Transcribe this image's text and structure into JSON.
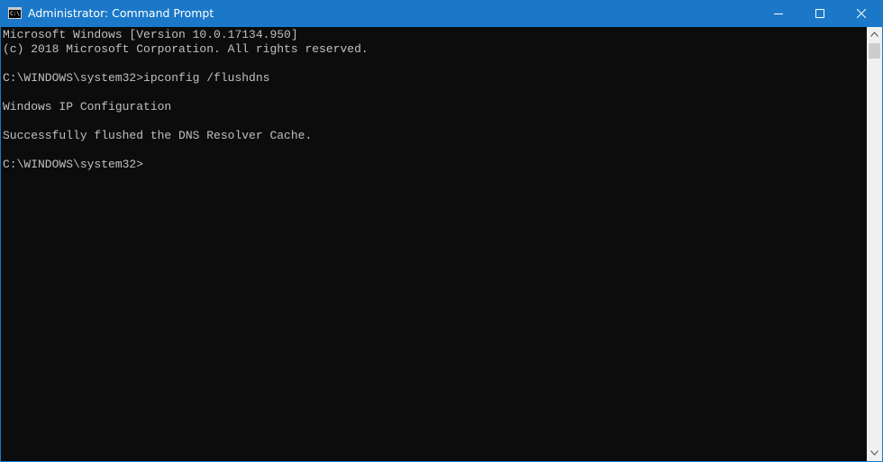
{
  "window": {
    "title": "Administrator: Command Prompt",
    "app_icon_glyph": "C:\\"
  },
  "titlebar": {
    "controls": [
      "minimize-icon",
      "maximize-icon",
      "close-icon"
    ]
  },
  "console": {
    "lines": [
      "Microsoft Windows [Version 10.0.17134.950]",
      "(c) 2018 Microsoft Corporation. All rights reserved.",
      "",
      "C:\\WINDOWS\\system32>ipconfig /flushdns",
      "",
      "Windows IP Configuration",
      "",
      "Successfully flushed the DNS Resolver Cache.",
      "",
      "C:\\WINDOWS\\system32>"
    ]
  },
  "scrollbar": {
    "icons": [
      "scroll-up-arrow-icon",
      "scroll-down-arrow-icon"
    ]
  },
  "colors": {
    "titlebar": "#1b78c9",
    "console_background": "#0c0c0c",
    "console_text": "#c0c0c0",
    "scrollbar_track": "#f0f0f0",
    "scrollbar_thumb": "#cdcdcd"
  }
}
